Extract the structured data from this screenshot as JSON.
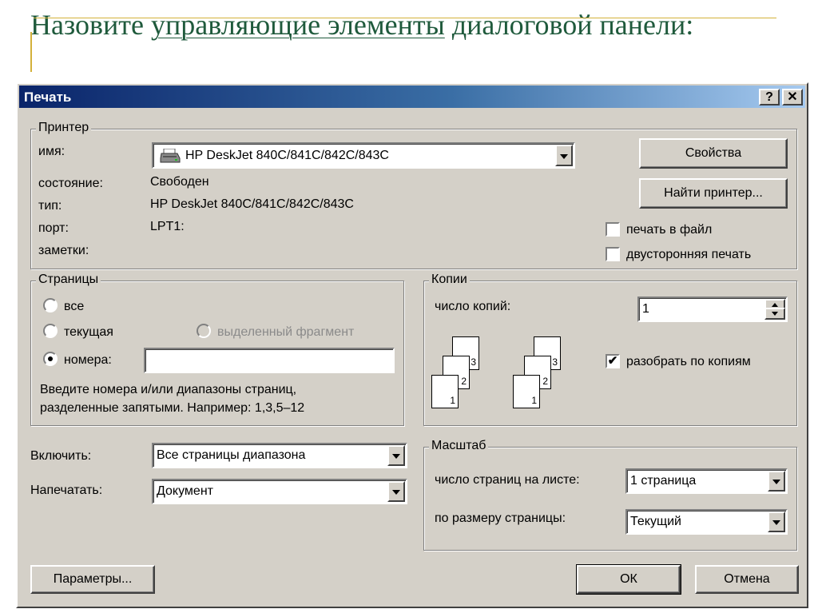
{
  "slide": {
    "title_part1": "Назовите ",
    "title_part2": "управляющие элементы",
    "title_part3": " диалоговой панели:"
  },
  "dialog": {
    "title": "Печать",
    "help_button": "?",
    "close_button": "✕",
    "printer": {
      "legend": "Принтер",
      "name_label": "имя:",
      "name_value": "HP DeskJet 840C/841C/842C/843C",
      "status_label": "состояние:",
      "status_value": "Свободен",
      "type_label": "тип:",
      "type_value": "HP DeskJet 840C/841C/842C/843C",
      "port_label": "порт:",
      "port_value": "LPT1:",
      "notes_label": "заметки:",
      "properties_button": "Свойства",
      "find_printer_button": "Найти принтер...",
      "print_to_file_label": "печать в файл",
      "print_to_file_checked": false,
      "duplex_label": "двусторонняя печать",
      "duplex_checked": false
    },
    "pages": {
      "legend": "Страницы",
      "all_label": "все",
      "current_label": "текущая",
      "selection_label": "выделенный фрагмент",
      "numbers_label": "номера:",
      "numbers_value": "",
      "selected_option": "numbers",
      "hint_line1": "Введите номера и/или диапазоны страниц,",
      "hint_line2": "разделенные запятыми. Например: 1,3,5–12"
    },
    "copies": {
      "legend": "Копии",
      "count_label": "число копий:",
      "count_value": "1",
      "collate_label": "разобрать по копиям",
      "collate_checked": true,
      "page_numbers": [
        "1",
        "2",
        "3"
      ]
    },
    "include_label": "Включить:",
    "include_value": "Все страницы диапазона",
    "print_what_label": "Напечатать:",
    "print_what_value": "Документ",
    "zoom": {
      "legend": "Масштаб",
      "pages_per_sheet_label": "число страниц на листе:",
      "pages_per_sheet_value": "1 страница",
      "scale_to_paper_label": "по размеру страницы:",
      "scale_to_paper_value": "Текущий"
    },
    "options_button": "Параметры...",
    "ok_button": "ОК",
    "cancel_button": "Отмена"
  },
  "colors": {
    "title_green": "#1f5a3c",
    "accent_gold": "#d3b13a",
    "dialog_face": "#d4d0c8",
    "titlebar_start": "#0a246a",
    "titlebar_end": "#a6caf0"
  }
}
